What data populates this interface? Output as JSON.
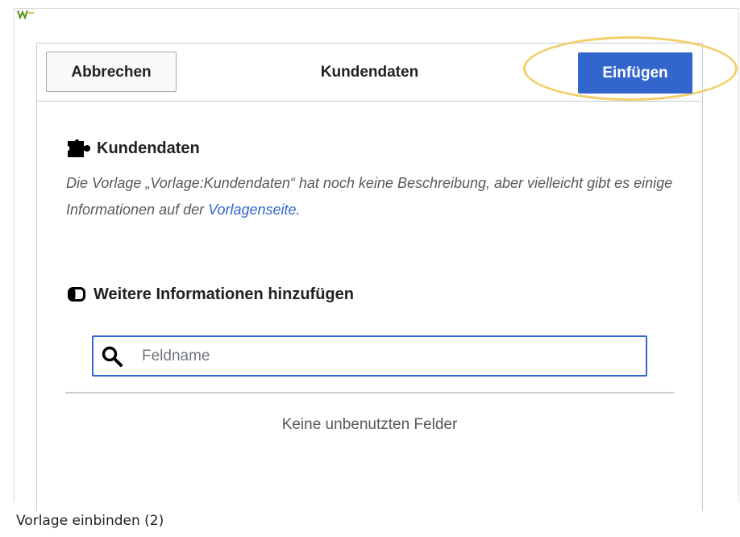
{
  "dialog": {
    "title": "Kundendaten",
    "cancel_label": "Abbrechen",
    "insert_label": "Einfügen",
    "accent_color": "#3366cc",
    "highlight_color": "#f1cf6c"
  },
  "template": {
    "heading": "Kundendaten",
    "description_text": "Die Vorlage „Vorlage:Kundendaten“ hat noch keine Beschreibung, aber vielleicht gibt es einige Informationen auf der ",
    "description_link": "Vorlagenseite",
    "description_end": "."
  },
  "more_info": {
    "heading": "Weitere Informationen hinzufügen",
    "search_placeholder": "Feldname",
    "search_value": "",
    "empty_message": "Keine unbenutzten Felder"
  },
  "caption": "Vorlage einbinden (2)",
  "icons": {
    "template": "puzzle-icon",
    "section": "toggle-icon",
    "search": "search-icon",
    "corner": "expand-image-icon"
  }
}
